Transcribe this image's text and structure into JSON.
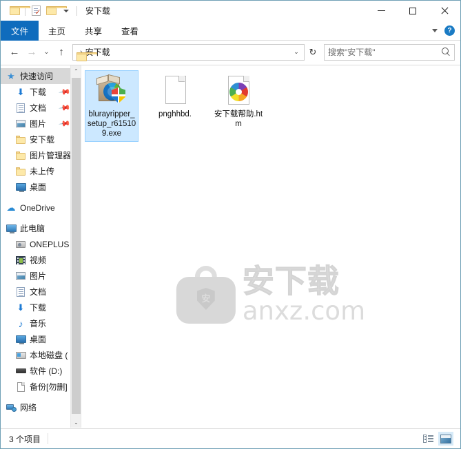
{
  "window": {
    "title": "安下载",
    "quick_access": [
      {
        "name": "folder-icon",
        "label": "文件资源管理器"
      },
      {
        "name": "properties-icon",
        "label": "属性"
      },
      {
        "name": "new-folder-icon",
        "label": "新建文件夹"
      },
      {
        "name": "customize-caret",
        "label": "自定义快速访问工具栏"
      }
    ],
    "controls": {
      "minimize": "最小化",
      "maximize": "最大化",
      "close": "关闭"
    }
  },
  "ribbon": {
    "tabs": [
      {
        "label": "文件",
        "active": true
      },
      {
        "label": "主页",
        "active": false
      },
      {
        "label": "共享",
        "active": false
      },
      {
        "label": "查看",
        "active": false
      }
    ],
    "collapse_label": "展开功能区",
    "help_label": "?"
  },
  "navbar": {
    "back": "←",
    "forward": "→",
    "recent": "⌄",
    "up": "↑",
    "breadcrumb": [
      "安下载"
    ],
    "breadcrumb_separator": "›",
    "address_dropdown": "⌄",
    "refresh": "↻"
  },
  "search": {
    "placeholder": "搜索\"安下载\"",
    "value": "",
    "icon": "search-icon"
  },
  "sidebar": {
    "items": [
      {
        "label": "快速访问",
        "icon": "star-icon",
        "indent": 0,
        "selected": true,
        "pinned": false
      },
      {
        "label": "下载",
        "icon": "download-icon",
        "indent": 1,
        "selected": false,
        "pinned": true
      },
      {
        "label": "文档",
        "icon": "document-icon",
        "indent": 1,
        "selected": false,
        "pinned": true
      },
      {
        "label": "图片",
        "icon": "pictures-icon",
        "indent": 1,
        "selected": false,
        "pinned": true
      },
      {
        "label": "安下载",
        "icon": "folder-icon",
        "indent": 1,
        "selected": false,
        "pinned": false
      },
      {
        "label": "图片管理器",
        "icon": "folder-icon",
        "indent": 1,
        "selected": false,
        "pinned": false
      },
      {
        "label": "未上传",
        "icon": "folder-icon",
        "indent": 1,
        "selected": false,
        "pinned": false
      },
      {
        "label": "桌面",
        "icon": "desktop-icon",
        "indent": 1,
        "selected": false,
        "pinned": false
      },
      {
        "label": "OneDrive",
        "icon": "cloud-icon",
        "indent": 0,
        "selected": false,
        "pinned": false,
        "gap_before": true
      },
      {
        "label": "此电脑",
        "icon": "this-pc-icon",
        "indent": 0,
        "selected": false,
        "pinned": false,
        "gap_before": true
      },
      {
        "label": "ONEPLUS",
        "icon": "phone-icon",
        "indent": 1,
        "selected": false,
        "pinned": false
      },
      {
        "label": "视频",
        "icon": "videos-icon",
        "indent": 1,
        "selected": false,
        "pinned": false
      },
      {
        "label": "图片",
        "icon": "pictures-icon",
        "indent": 1,
        "selected": false,
        "pinned": false
      },
      {
        "label": "文档",
        "icon": "document-icon",
        "indent": 1,
        "selected": false,
        "pinned": false
      },
      {
        "label": "下载",
        "icon": "download-icon",
        "indent": 1,
        "selected": false,
        "pinned": false
      },
      {
        "label": "音乐",
        "icon": "music-icon",
        "indent": 1,
        "selected": false,
        "pinned": false
      },
      {
        "label": "桌面",
        "icon": "desktop-icon",
        "indent": 1,
        "selected": false,
        "pinned": false
      },
      {
        "label": "本地磁盘 (",
        "icon": "local-disk-icon",
        "indent": 1,
        "selected": false,
        "pinned": false
      },
      {
        "label": "软件 (D:)",
        "icon": "drive-icon",
        "indent": 1,
        "selected": false,
        "pinned": false
      },
      {
        "label": "备份[勿删]",
        "icon": "file-icon",
        "indent": 1,
        "selected": false,
        "pinned": false
      },
      {
        "label": "网络",
        "icon": "network-icon",
        "indent": 0,
        "selected": false,
        "pinned": false,
        "gap_before": true
      }
    ],
    "scroll_up": "⌃",
    "scroll_down": "⌄"
  },
  "files": [
    {
      "name": "blurayripper_setup_r615109.exe",
      "icon": "installer-package-icon",
      "selected": true
    },
    {
      "name": "pnghhbd.",
      "icon": "blank-document-icon",
      "selected": false
    },
    {
      "name": "安下载帮助.htm",
      "icon": "html-document-icon",
      "selected": false
    }
  ],
  "watermark": {
    "shield_glyph": "安",
    "brand_cn": "安下载",
    "brand_en": "anxz.com"
  },
  "statusbar": {
    "item_count_text": "3 个项目",
    "views": [
      {
        "name": "details-view-button",
        "label": "详细信息",
        "active": false
      },
      {
        "name": "large-icons-view-button",
        "label": "大图标",
        "active": true
      }
    ]
  },
  "colors": {
    "accent": "#0f6cbd",
    "selection_fill": "#cce8ff",
    "selection_border": "#99d1ff",
    "nav_selected": "#d8d8d8",
    "window_border": "#6fa0b5",
    "help_blue": "#1a7bc4"
  }
}
